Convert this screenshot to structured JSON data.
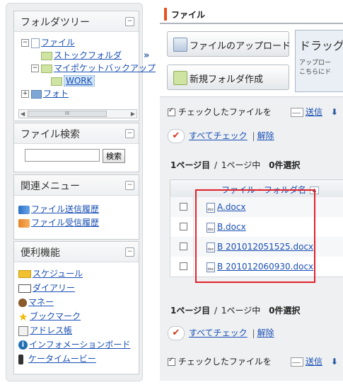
{
  "sidebar": {
    "folder_tree": {
      "title": "フォルダツリー",
      "items": [
        {
          "label": "ファイル"
        },
        {
          "label": "ストックフォルダ"
        },
        {
          "label": "マイポケットバックアップ"
        },
        {
          "label": "WORK"
        },
        {
          "label": "フォト"
        }
      ],
      "scroll_label": "III"
    },
    "file_search": {
      "title": "ファイル検索",
      "query": "",
      "search_button": "検索"
    },
    "related_menu": {
      "title": "関連メニュー",
      "items": [
        {
          "label": "ファイル送信履歴",
          "icon": "send-history-icon"
        },
        {
          "label": "ファイル受信履歴",
          "icon": "receive-history-icon"
        }
      ]
    },
    "tools": {
      "title": "便利機能",
      "items": [
        {
          "label": "スケジュール",
          "icon": "schedule-icon",
          "color": "#f2c12e"
        },
        {
          "label": "ダイアリー",
          "icon": "diary-icon",
          "color": "#555555"
        },
        {
          "label": "マネー",
          "icon": "money-icon",
          "color": "#8a5a2b"
        },
        {
          "label": "ブックマーク",
          "icon": "star-icon",
          "color": "#f5b800"
        },
        {
          "label": "アドレス帳",
          "icon": "address-book-icon",
          "color": "#777777"
        },
        {
          "label": "インフォメーションボード",
          "icon": "info-icon",
          "color": "#1f6fb2"
        },
        {
          "label": "ケータイムービー",
          "icon": "mobile-icon",
          "color": "#333333"
        }
      ]
    }
  },
  "main": {
    "tab_title": "ファイル",
    "upload_button": "ファイルのアップロード",
    "new_folder_button": "新規フォルダ作成",
    "drag_title": "ドラッグ",
    "drag_desc_line1": "アップロー",
    "drag_desc_line2": "こちらにド",
    "checked_files_label": "チェックしたファイルを",
    "send_label": "送信",
    "check_all": "すべてチェック",
    "separator": "|",
    "uncheck": "解除",
    "pager": {
      "page_text": "1ページ目",
      "slash": "/",
      "total_text": "1ページ中",
      "selected_text": "0件選択"
    },
    "table": {
      "header": "ファイル・フォルダ名",
      "rows": [
        {
          "name": "A.docx"
        },
        {
          "name": "B.docx"
        },
        {
          "name": "B 201012051525.docx"
        },
        {
          "name": "B 201012060930.docx"
        }
      ]
    }
  },
  "colors": {
    "accent": "#e8501e",
    "highlight_box": "#e1212b",
    "link": "#1a4fb4"
  }
}
